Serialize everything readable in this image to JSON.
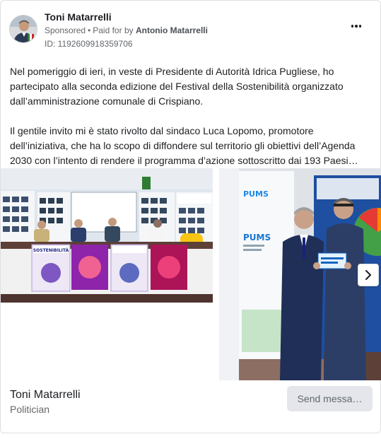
{
  "ad": {
    "page_name": "Toni Matarrelli",
    "sponsored_label": "Sponsored",
    "paid_for_prefix": "Paid for by",
    "paid_for_name": "Antonio Matarrelli",
    "ad_id": "ID: 1192609918359706",
    "body_paragraph_1": "Nel pomeriggio di ieri, in veste di Presidente di Autorità Idrica Pugliese, ho partecipato alla seconda edizione del Festival della Sostenibilità organizzato dall’amministrazione comunale di Crispiano.",
    "body_paragraph_2": "Il gentile invito mi è stato rivolto dal sindaco Luca Lopomo, promotore dell’iniziativa, che ha lo scopo di diffondere sul territorio gli obiettivi dell’Agenda 2030 con l’intento di rendere il programma d’azione sottoscritto dai 193 Paesi…"
  },
  "carousel": {
    "slide1_banner": "SOSTENIBILITÀ",
    "slide2_banner_top": "PUMS",
    "slide2_banner_mid": "PUMS"
  },
  "footer": {
    "name": "Toni Matarrelli",
    "category": "Politician",
    "cta_label": "Send messa…"
  },
  "icons": {
    "more": "more-options-icon",
    "next": "chevron-right-icon"
  },
  "colors": {
    "text": "#1c1e21",
    "secondary": "#65676b",
    "button_bg": "#e4e6eb",
    "border": "#dddfe2"
  }
}
